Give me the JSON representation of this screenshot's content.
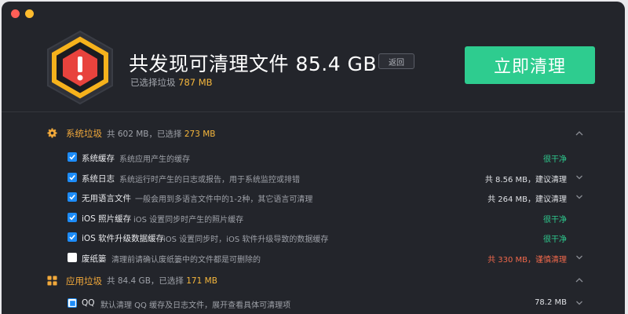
{
  "header": {
    "title": "共发现可清理文件 85.4 GB",
    "back_label": "返回",
    "subtitle_prefix": "已选择垃圾",
    "subtitle_amount": "787 MB",
    "clean_button": "立即清理",
    "logo_icon": "warning-hexagon-icon"
  },
  "colors": {
    "accent_green": "#2ecc8f",
    "accent_orange": "#f2a93b",
    "check_blue": "#1d8cf8",
    "danger": "#f0684b",
    "background": "#23252b"
  },
  "sections": [
    {
      "title": "系统垃圾",
      "meta_prefix": "共 602 MB，已选择",
      "meta_amount": "273 MB",
      "icon": "gear-icon",
      "expanded": true,
      "items": [
        {
          "checked": true,
          "name": "系统缓存",
          "desc": "系统应用产生的缓存",
          "status": "很干净",
          "status_type": "green",
          "expandable": false
        },
        {
          "checked": true,
          "name": "系统日志",
          "desc": "系统运行时产生的日志或报告，用于系统监控或排错",
          "status": "共 8.56 MB，建议清理",
          "status_type": "white",
          "expandable": true
        },
        {
          "checked": true,
          "name": "无用语言文件",
          "desc": "一般会用到多语言文件中的1-2种，其它语言可清理",
          "status": "共 264 MB，建议清理",
          "status_type": "white",
          "expandable": true
        },
        {
          "checked": true,
          "name": "iOS 照片缓存",
          "desc": "iOS 设置同步时产生的照片缓存",
          "status": "很干净",
          "status_type": "green",
          "expandable": false
        },
        {
          "checked": true,
          "name": "iOS 软件升级数据缓存",
          "desc": "iOS 设置同步时，iOS 软件升级导致的数据缓存",
          "status": "很干净",
          "status_type": "green",
          "expandable": false
        },
        {
          "checked": false,
          "name": "废纸篓",
          "desc": "清理前请确认废纸篓中的文件都是可删除的",
          "status": "共 330 MB，谨慎清理",
          "status_type": "orange",
          "expandable": true
        }
      ]
    },
    {
      "title": "应用垃圾",
      "meta_prefix": "共 84.4 GB，已选择",
      "meta_amount": "171 MB",
      "icon": "apps-grid-icon",
      "expanded": true,
      "items": [
        {
          "checked": "partial",
          "name": "QQ",
          "desc": "默认清理 QQ 缓存及日志文件，展开查看具体可清理项",
          "status": "78.2 MB",
          "status_type": "white",
          "expandable": true
        }
      ]
    }
  ]
}
